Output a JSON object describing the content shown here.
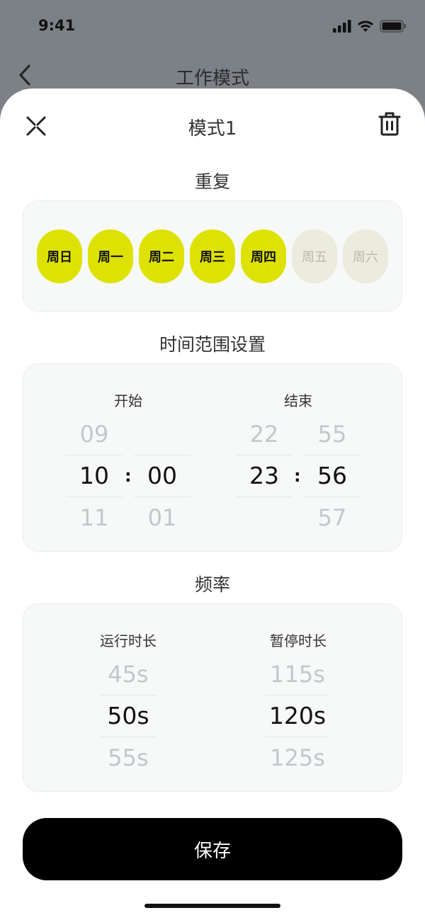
{
  "status_bar": {
    "time": "9:41"
  },
  "background_page": {
    "title": "工作模式"
  },
  "sheet": {
    "title": "模式1",
    "repeat": {
      "title": "重复",
      "days": [
        {
          "label": "周日",
          "selected": true
        },
        {
          "label": "周一",
          "selected": true
        },
        {
          "label": "周二",
          "selected": true
        },
        {
          "label": "周三",
          "selected": true
        },
        {
          "label": "周四",
          "selected": true
        },
        {
          "label": "周五",
          "selected": false
        },
        {
          "label": "周六",
          "selected": false
        }
      ]
    },
    "time_range": {
      "title": "时间范围设置",
      "start": {
        "label": "开始",
        "hour": {
          "prev": "09",
          "value": "10",
          "next": "11"
        },
        "minute": {
          "prev": "",
          "value": "00",
          "next": "01"
        }
      },
      "end": {
        "label": "结束",
        "hour": {
          "prev": "22",
          "value": "23",
          "next": ""
        },
        "minute": {
          "prev": "55",
          "value": "56",
          "next": "57"
        }
      },
      "separator": ":"
    },
    "frequency": {
      "title": "频率",
      "run": {
        "label": "运行时长",
        "prev": "45s",
        "value": "50s",
        "next": "55s"
      },
      "pause": {
        "label": "暂停时长",
        "prev": "115s",
        "value": "120s",
        "next": "125s"
      }
    },
    "save_label": "保存"
  },
  "colors": {
    "accent": "#dde203",
    "primary_button": "#000000",
    "card_bg": "#f7f8f8"
  }
}
